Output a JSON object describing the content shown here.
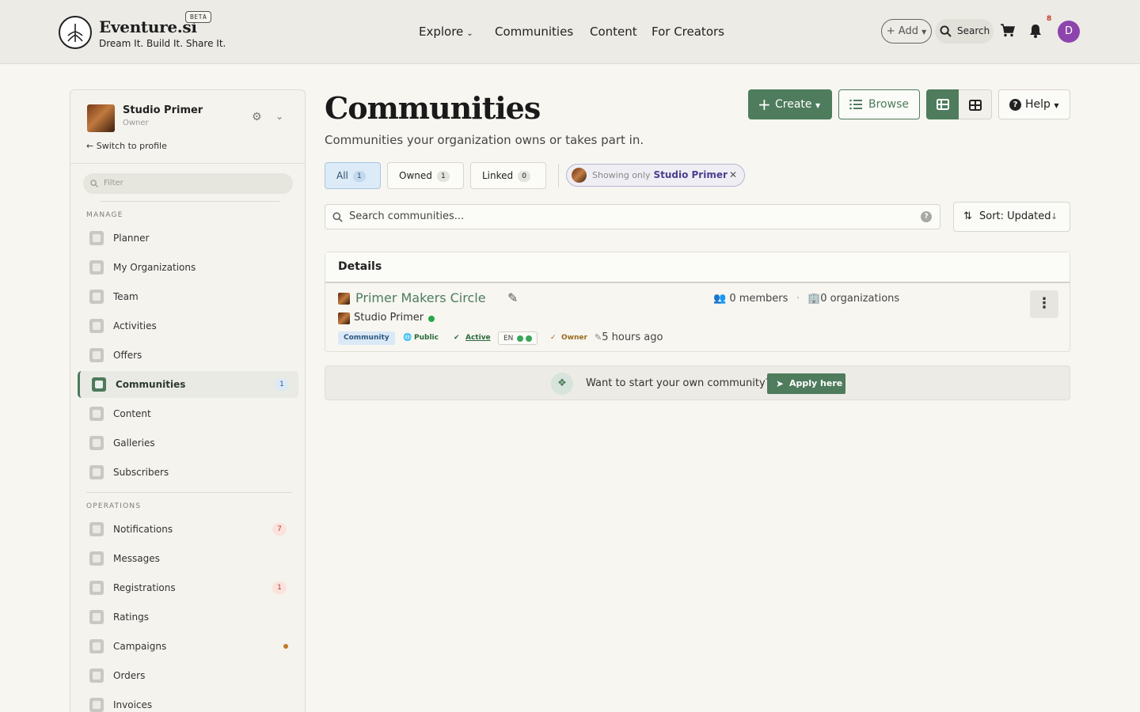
{
  "header": {
    "brand": "Eventure.si",
    "beta": "BETA",
    "tagline": "Dream It. Build It. Share It.",
    "nav": [
      "Explore",
      "Communities",
      "Content",
      "For Creators"
    ],
    "add_label": "+ Add",
    "search_label": "Search",
    "notification_count": "8",
    "avatar_initial": "D"
  },
  "sidebar": {
    "org_name": "Studio Primer",
    "org_role": "Owner",
    "switch_label": "Switch to profile",
    "filter_placeholder": "Filter",
    "manage_title": "MANAGE",
    "manage_items": [
      {
        "label": "Planner"
      },
      {
        "label": "My Organizations"
      },
      {
        "label": "Team"
      },
      {
        "label": "Activities"
      },
      {
        "label": "Offers"
      },
      {
        "label": "Communities",
        "badge": "1"
      },
      {
        "label": "Content"
      },
      {
        "label": "Galleries"
      },
      {
        "label": "Subscribers"
      }
    ],
    "operations_title": "OPERATIONS",
    "operations_items": [
      {
        "label": "Notifications",
        "badge": "7"
      },
      {
        "label": "Messages"
      },
      {
        "label": "Registrations",
        "badge": "1"
      },
      {
        "label": "Ratings"
      },
      {
        "label": "Campaigns"
      },
      {
        "label": "Orders"
      },
      {
        "label": "Invoices"
      }
    ]
  },
  "main": {
    "title": "Communities",
    "subtitle": "Communities your organization owns or takes part in.",
    "create_label": "Create",
    "browse_label": "Browse",
    "help_label": "Help",
    "tabs": [
      {
        "label": "All",
        "count": "1"
      },
      {
        "label": "Owned",
        "count": "1"
      },
      {
        "label": "Linked",
        "count": "0"
      }
    ],
    "showing_prefix": "Showing only",
    "showing_name": "Studio Primer",
    "search_placeholder": "Search communities...",
    "sort_label": "Sort: Updated",
    "details_header": "Details",
    "community": {
      "name": "Primer Makers Circle",
      "org": "Studio Primer",
      "members": "0 members",
      "organizations": "0 organizations",
      "tag_type": "Community",
      "tag_visibility": "Public",
      "tag_status": "Active",
      "tag_lang": "EN",
      "tag_role": "Owner",
      "updated": "5 hours ago"
    },
    "apply_text": "Want to start your own community?",
    "apply_button": "Apply here"
  },
  "colors": {
    "accent": "#4e7c5d",
    "avatar": "#8e44ad"
  }
}
